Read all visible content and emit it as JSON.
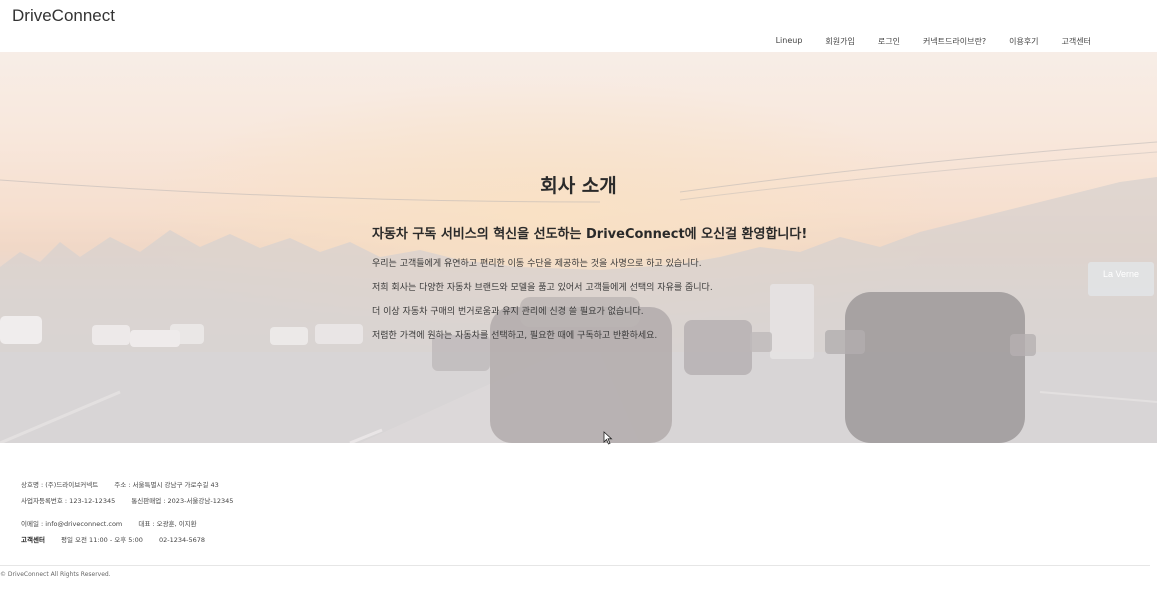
{
  "header": {
    "brand": "DriveConnect",
    "nav": [
      "Lineup",
      "회원가입",
      "로그인",
      "커넥트드라이브란?",
      "이용후기",
      "고객센터"
    ]
  },
  "hero": {
    "title": "회사 소개",
    "subtitle": "자동차 구독 서비스의 혁신을 선도하는 DriveConnect에 오신걸 환영합니다!",
    "lines": [
      "우리는 고객들에게 유연하고 편리한 이동 수단을 제공하는 것을 사명으로 하고 있습니다.",
      "저희 회사는 다양한 자동차 브랜드와 모델을 품고 있어서 고객들에게 선택의 자유를 줍니다.",
      "더 이상 자동차 구매의 번거로움과 유지 관리에 신경 쓸 필요가 없습니다.",
      "저렴한 가격에 원하는 자동차를 선택하고, 필요한 때에 구독하고 반환하세요."
    ],
    "sign_text": "La Verne"
  },
  "footer": {
    "company": "상호명 : (주)드라이브커넥트",
    "address": "주소 : 서울특별시 강남구 가로수길 43",
    "biz_number": "사업자등록번호 : 123-12-12345",
    "mail_order": "통신판매업 : 2023-서울강남-12345",
    "email": "이메일 : info@driveconnect.com",
    "ceo": "대표 : 오광훈, 이지환",
    "cs_label": "고객센터",
    "cs_hours": "평일 오전 11:00 - 오후 5:00",
    "cs_phone": "02-1234-5678",
    "copyright": "© DriveConnect All Rights Reserved."
  },
  "colors": {
    "hero_sky_top": "#f3e4da",
    "hero_sky_glow": "#f2cfb6",
    "hero_road": "#c7c2c3",
    "text_dark": "#2a2a2a"
  }
}
